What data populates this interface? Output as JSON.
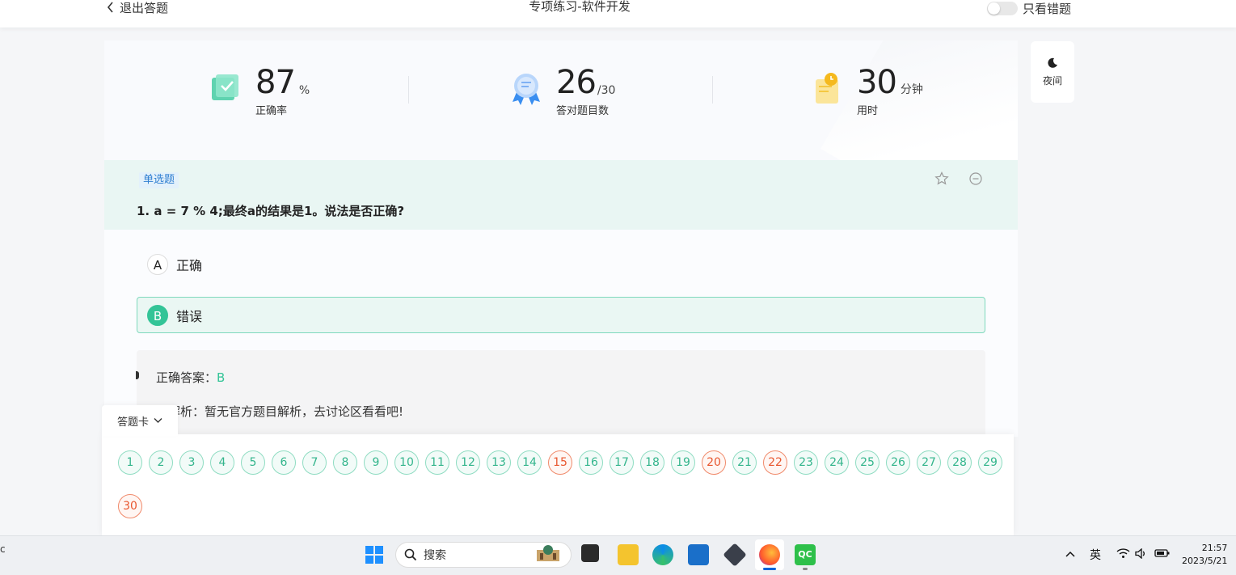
{
  "topbar": {
    "back_label": "退出答题",
    "title": "专项练习-软件开发",
    "wrong_only_label": "只看错题"
  },
  "stats": {
    "accuracy": {
      "value": "87",
      "unit": "%",
      "label": "正确率"
    },
    "correct": {
      "value": "26",
      "unit": "/30",
      "label": "答对题目数"
    },
    "time": {
      "value": "30",
      "unit": "分钟",
      "label": "用时"
    }
  },
  "night_mode": {
    "label": "夜间",
    "icon": "moon-icon"
  },
  "question": {
    "type": "单选题",
    "number": "1.",
    "text": "a = 7 % 4;最终a的结果是1。说法是否正确?",
    "options": [
      {
        "letter": "A",
        "text": "正确"
      },
      {
        "letter": "B",
        "text": "错误"
      }
    ],
    "correct_label": "正确答案：",
    "correct_value": "B",
    "analysis": "方解析：暂无官方题目解析，去讨论区看看吧!"
  },
  "answer_card": {
    "tab_label": "答题卡",
    "numbers": [
      "1",
      "2",
      "3",
      "4",
      "5",
      "6",
      "7",
      "8",
      "9",
      "10",
      "11",
      "12",
      "13",
      "14",
      "15",
      "16",
      "17",
      "18",
      "19",
      "20",
      "21",
      "22",
      "23",
      "24",
      "25",
      "26",
      "27",
      "28",
      "29",
      "30"
    ],
    "wrong": [
      "15",
      "20",
      "22",
      "30"
    ]
  },
  "taskbar": {
    "search_placeholder": "搜索",
    "ime": "英",
    "time": "21:57",
    "date": "2023/5/21"
  },
  "colors": {
    "accent_green": "#33c497",
    "wrong_red": "#e8572f",
    "tag_blue": "#2f7fd1"
  }
}
